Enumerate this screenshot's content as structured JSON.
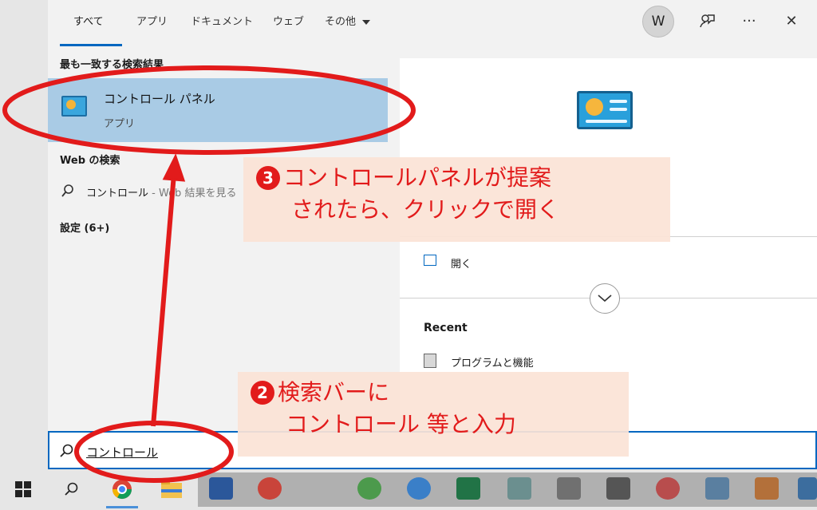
{
  "tabs": [
    {
      "label": "すべて",
      "active": true
    },
    {
      "label": "アプリ"
    },
    {
      "label": "ドキュメント"
    },
    {
      "label": "ウェブ"
    },
    {
      "label": "その他"
    }
  ],
  "header": {
    "avatar_letter": "W",
    "feedback_icon": "feedback-icon",
    "more_label": "···",
    "close_label": "✕"
  },
  "results": {
    "best_match_title": "最も一致する検索結果",
    "best_match": {
      "name": "コントロール パネル",
      "type": "アプリ",
      "icon": "control-panel-icon"
    },
    "web_title": "Web の検索",
    "web_query": "コントロール",
    "web_suffix": " - Web 結果を見る",
    "settings_title": "設定 (6+)"
  },
  "preview": {
    "open_label": "開く",
    "recent_title": "Recent",
    "recent_items": [
      "プログラムと機能"
    ]
  },
  "search": {
    "query": "コントロール"
  },
  "annotations": {
    "step3_num": "3",
    "step3_line1": "コントロールパネルが提案",
    "step3_line2": "されたら、クリックで開く",
    "step2_num": "2",
    "step2_line1": "検索バーに",
    "step2_line2": "コントロール 等と入力",
    "color": "#e21b1b"
  },
  "taskbar": {
    "items": [
      "windows-start-icon",
      "search-icon",
      "chrome-icon",
      "file-explorer-icon",
      "word-icon",
      "powerpoint-icon",
      "line-icon",
      "zoom-icon",
      "excel-icon",
      "notepad-icon",
      "calculator-icon",
      "timer-icon",
      "snipping-icon",
      "whiteboard-icon",
      "photos-icon",
      "edge-icon"
    ]
  }
}
